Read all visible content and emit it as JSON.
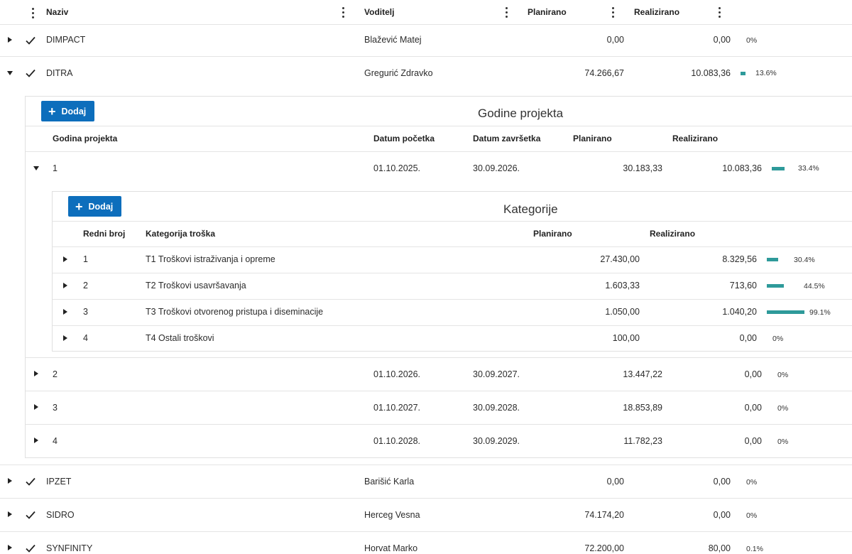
{
  "columns": {
    "name": "Naziv",
    "lead": "Voditelj",
    "planned": "Planirano",
    "realized": "Realizirano"
  },
  "projects": [
    {
      "name": "DIMPACT",
      "lead": "Blažević Matej",
      "planned": "0,00",
      "realized": "0,00",
      "pct_label": "0%",
      "pct": 0
    },
    {
      "name": "DITRA",
      "lead": "Gregurić Zdravko",
      "planned": "74.266,67",
      "realized": "10.083,36",
      "pct_label": "13.6%",
      "pct": 0.136
    },
    {
      "name": "IPZET",
      "lead": "Barišić Karla",
      "planned": "0,00",
      "realized": "0,00",
      "pct_label": "0%",
      "pct": 0
    },
    {
      "name": "SIDRO",
      "lead": "Herceg Vesna",
      "planned": "74.174,20",
      "realized": "0,00",
      "pct_label": "0%",
      "pct": 0
    },
    {
      "name": "SYNFINITY",
      "lead": "Horvat Marko",
      "planned": "72.200,00",
      "realized": "80,00",
      "pct_label": "0.1%",
      "pct": 0.001
    }
  ],
  "years_panel": {
    "add_label": "Dodaj",
    "title": "Godine projekta",
    "columns": {
      "year": "Godina projekta",
      "start": "Datum početka",
      "end": "Datum završetka",
      "planned": "Planirano",
      "realized": "Realizirano"
    },
    "rows": [
      {
        "year": "1",
        "start": "01.10.2025.",
        "end": "30.09.2026.",
        "planned": "30.183,33",
        "realized": "10.083,36",
        "pct_label": "33.4%",
        "pct": 0.334
      },
      {
        "year": "2",
        "start": "01.10.2026.",
        "end": "30.09.2027.",
        "planned": "13.447,22",
        "realized": "0,00",
        "pct_label": "0%",
        "pct": 0
      },
      {
        "year": "3",
        "start": "01.10.2027.",
        "end": "30.09.2028.",
        "planned": "18.853,89",
        "realized": "0,00",
        "pct_label": "0%",
        "pct": 0
      },
      {
        "year": "4",
        "start": "01.10.2028.",
        "end": "30.09.2029.",
        "planned": "11.782,23",
        "realized": "0,00",
        "pct_label": "0%",
        "pct": 0
      }
    ]
  },
  "categories_panel": {
    "add_label": "Dodaj",
    "title": "Kategorije",
    "columns": {
      "no": "Redni broj",
      "category": "Kategorija troška",
      "planned": "Planirano",
      "realized": "Realizirano"
    },
    "rows": [
      {
        "no": "1",
        "category": "T1 Troškovi istraživanja i opreme",
        "planned": "27.430,00",
        "realized": "8.329,56",
        "pct_label": "30.4%",
        "pct": 0.304
      },
      {
        "no": "2",
        "category": "T2 Troškovi usavršavanja",
        "planned": "1.603,33",
        "realized": "713,60",
        "pct_label": "44.5%",
        "pct": 0.445
      },
      {
        "no": "3",
        "category": "T3 Troškovi otvorenog pristupa i diseminacije",
        "planned": "1.050,00",
        "realized": "1.040,20",
        "pct_label": "99.1%",
        "pct": 0.991
      },
      {
        "no": "4",
        "category": "T4 Ostali troškovi",
        "planned": "100,00",
        "realized": "0,00",
        "pct_label": "0%",
        "pct": 0
      }
    ]
  },
  "colors": {
    "accent": "#0d6ebc",
    "progress": "#2e9a9a"
  }
}
